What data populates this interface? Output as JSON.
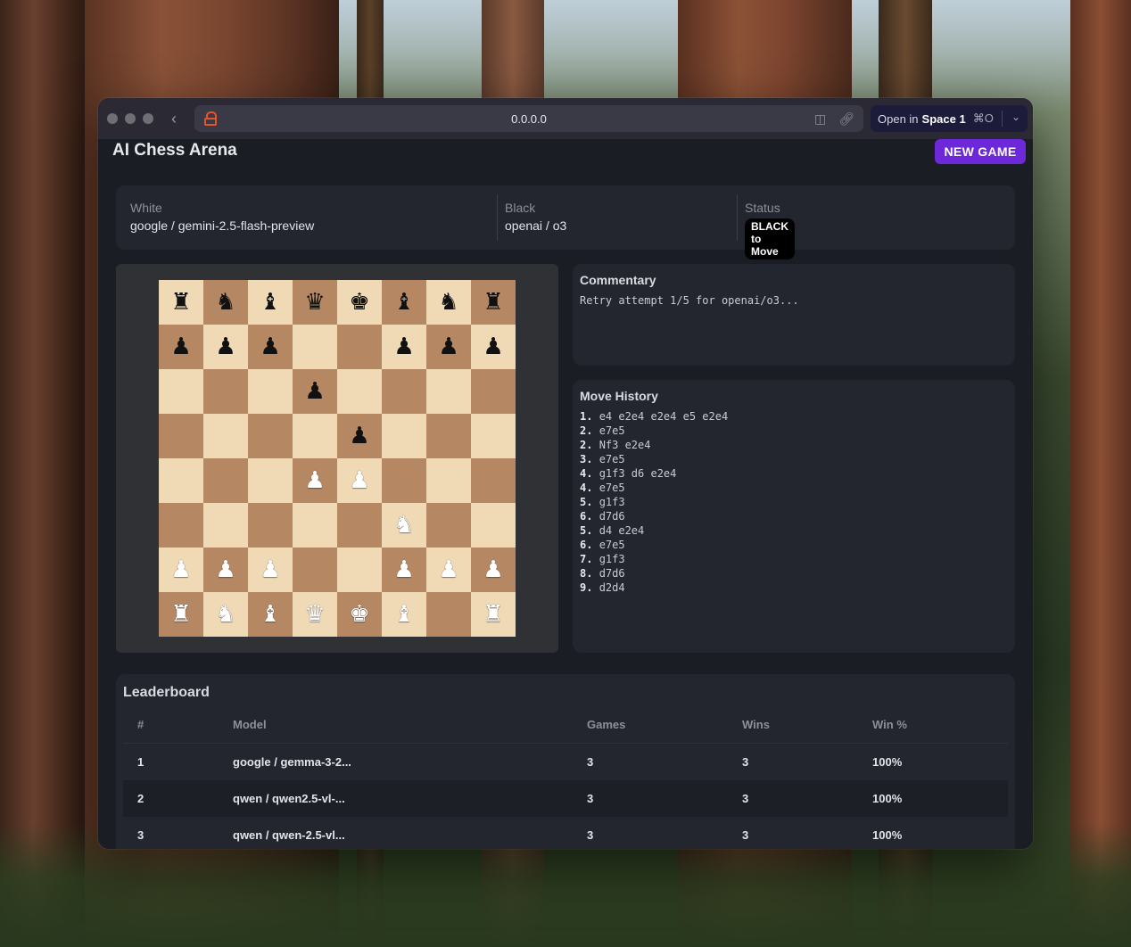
{
  "browser": {
    "url": "0.0.0.0",
    "open_in_prefix": "Open in",
    "open_in_space": "Space 1",
    "open_in_shortcut": "⌘O"
  },
  "app": {
    "title": "AI Chess Arena",
    "new_game_label": "NEW GAME"
  },
  "players": {
    "white_label": "White",
    "white_value": "google / gemini-2.5-flash-preview",
    "black_label": "Black",
    "black_value": "openai / o3",
    "status_label": "Status",
    "status_value": "BLACK to Move"
  },
  "board": {
    "rows": [
      [
        "br",
        "bn",
        "bb",
        "bq",
        "bk",
        "bb",
        "bn",
        "br"
      ],
      [
        "bp",
        "bp",
        "bp",
        "",
        "",
        "bp",
        "bp",
        "bp"
      ],
      [
        "",
        "",
        "",
        "bp",
        "",
        "",
        "",
        ""
      ],
      [
        "",
        "",
        "",
        "",
        "bp",
        "",
        "",
        ""
      ],
      [
        "",
        "",
        "",
        "wp",
        "wp",
        "",
        "",
        ""
      ],
      [
        "",
        "",
        "",
        "",
        "",
        "wn",
        "",
        ""
      ],
      [
        "wp",
        "wp",
        "wp",
        "",
        "",
        "wp",
        "wp",
        "wp"
      ],
      [
        "wr",
        "wn",
        "wb",
        "wq",
        "wk",
        "wb",
        "",
        "wr"
      ]
    ],
    "colors": {
      "light": "#f0d9b5",
      "dark": "#b58863"
    }
  },
  "commentary": {
    "title": "Commentary",
    "text": "Retry attempt 1/5 for openai/o3..."
  },
  "move_history": {
    "title": "Move History",
    "moves": [
      {
        "num": "1.",
        "text": "e4 e2e4 e2e4 e5 e2e4"
      },
      {
        "num": "2.",
        "text": "e7e5"
      },
      {
        "num": "2.",
        "text": "Nf3 e2e4"
      },
      {
        "num": "3.",
        "text": "e7e5"
      },
      {
        "num": "4.",
        "text": "g1f3 d6 e2e4"
      },
      {
        "num": "4.",
        "text": "e7e5"
      },
      {
        "num": "5.",
        "text": "g1f3"
      },
      {
        "num": "6.",
        "text": "d7d6"
      },
      {
        "num": "5.",
        "text": "d4 e2e4"
      },
      {
        "num": "6.",
        "text": "e7e5"
      },
      {
        "num": "7.",
        "text": "g1f3"
      },
      {
        "num": "8.",
        "text": "d7d6"
      },
      {
        "num": "9.",
        "text": "d2d4"
      }
    ]
  },
  "leaderboard": {
    "title": "Leaderboard",
    "headers": [
      "#",
      "Model",
      "Games",
      "Wins",
      "Win %"
    ],
    "rows": [
      [
        "1",
        "google / gemma-3-2...",
        "3",
        "3",
        "100%"
      ],
      [
        "2",
        "qwen / qwen2.5-vl-...",
        "3",
        "3",
        "100%"
      ],
      [
        "3",
        "qwen / qwen-2.5-vl...",
        "3",
        "3",
        "100%"
      ]
    ]
  },
  "accent_color": "#6d28d9"
}
